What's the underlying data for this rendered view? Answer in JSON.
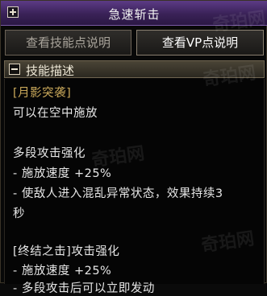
{
  "window": {
    "title": "急速斩击"
  },
  "buttons": {
    "skill_points": "查看技能点说明",
    "vp_points": "查看VP点说明"
  },
  "section": {
    "title": "技能描述"
  },
  "description": [
    {
      "text": "[月影突袭]",
      "color": "gold"
    },
    {
      "text": "可以在空中施放",
      "color": "white"
    },
    {
      "text": "",
      "color": "white"
    },
    {
      "text": "多段攻击强化",
      "color": "white"
    },
    {
      "text": "- 施放速度 +25%",
      "color": "white"
    },
    {
      "text": "- 使敌人进入混乱异常状态，效果持续3",
      "color": "white"
    },
    {
      "text": "秒",
      "color": "white"
    },
    {
      "text": "",
      "color": "white"
    },
    {
      "text": "[终结之击]攻击强化",
      "color": "white"
    },
    {
      "text": "- 施放速度 +25%",
      "color": "white"
    },
    {
      "text": "- 多段攻击后可以立即发动",
      "color": "white"
    }
  ],
  "watermarks": [
    "奇珀网",
    "奇珀网",
    "奇珀网",
    "奇珀网"
  ],
  "colors": {
    "title_bar": "#3a2257",
    "gold_text": "#c9a85a",
    "body_text": "#e6e6e6"
  }
}
